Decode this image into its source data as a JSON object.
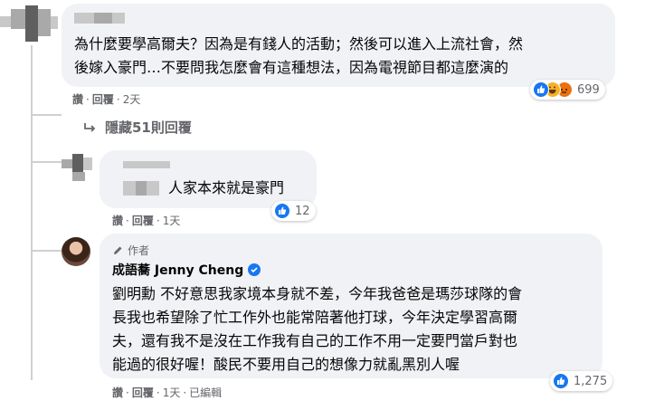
{
  "comments": [
    {
      "text_line1": "為什麼要學高爾夫？因為是有錢人的活動；然後可以進入上流社會，然",
      "text_line2": "後嫁入豪門…不要問我怎麼會有這種想法，因為電視節目都這麼演的",
      "reaction_count": "699",
      "actions": {
        "like": "讚",
        "reply": "回覆",
        "time": "2天"
      }
    }
  ],
  "hidden_replies": "隱藏51則回覆",
  "reply1": {
    "text": "人家本來就是豪門",
    "reaction_count": "12",
    "actions": {
      "like": "讚",
      "reply": "回覆",
      "time": "1天"
    }
  },
  "reply2": {
    "author_tag": "作者",
    "author_name": "成語蕎 Jenny Cheng",
    "lines": [
      "劉明勳 不好意思我家境本身就不差，今年我爸爸是瑪莎球隊的會",
      "長我也希望除了忙工作外也能常陪著他打球，今年決定學習高爾",
      "夫，還有我不是沒在工作我有自己的工作不用一定要門當戶對也",
      "能過的很好喔！酸民不要用自己的想像力就亂黑別人喔"
    ],
    "reaction_count": "1,275",
    "actions": {
      "like": "讚",
      "reply": "回覆",
      "time": "1天",
      "edited": "已編輯"
    }
  },
  "colors": {
    "bubble": "#f0f2f5",
    "secondary_text": "#65676b",
    "like_blue": "#1877f2",
    "haha_yellow": "#f7b125",
    "angry_orange": "#e9710f",
    "verified_blue": "#1877f2"
  }
}
